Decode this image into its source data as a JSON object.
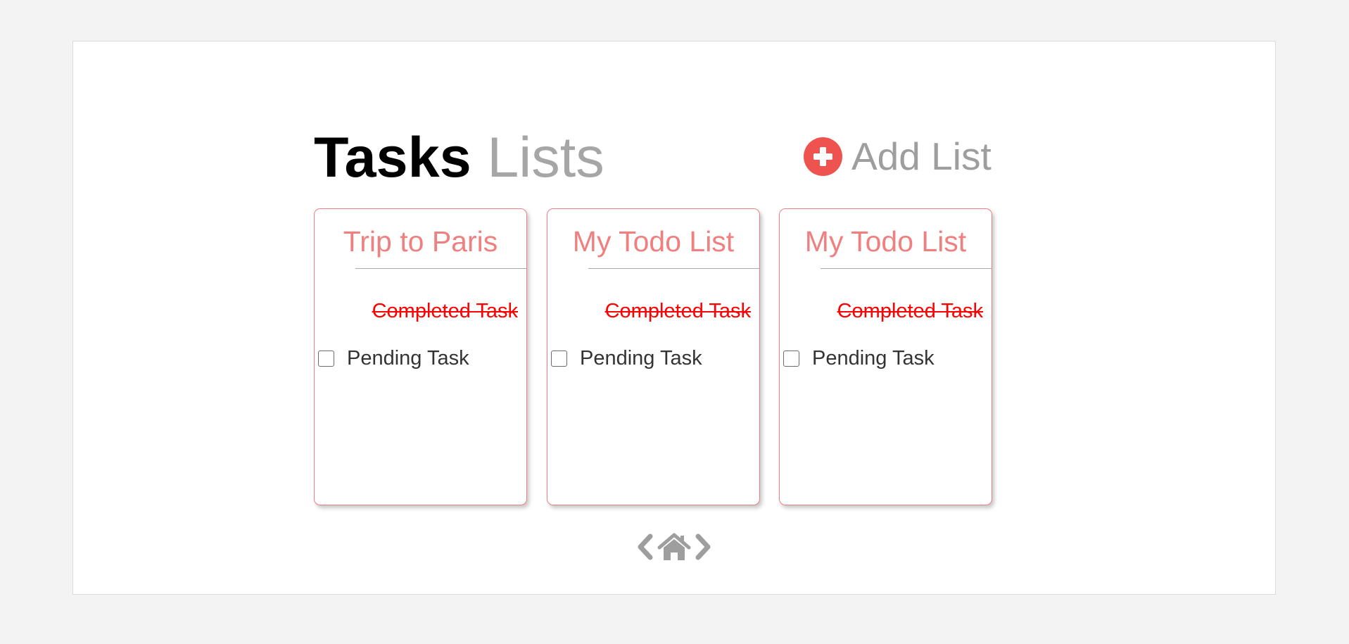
{
  "header": {
    "title_bold": "Tasks",
    "title_light": "Lists",
    "add_list_label": "Add List",
    "add_list_icon": "plus-circle-icon"
  },
  "lists": [
    {
      "title": "Trip to Paris",
      "completed_task": "Completed Task",
      "pending_task": "Pending Task",
      "pending_checked": false
    },
    {
      "title": "My Todo List",
      "completed_task": "Completed Task",
      "pending_task": "Pending Task",
      "pending_checked": false
    },
    {
      "title": "My Todo List",
      "completed_task": "Completed Task",
      "pending_task": "Pending Task",
      "pending_checked": false
    }
  ],
  "pager": {
    "prev_icon": "chevron-left-icon",
    "home_icon": "home-icon",
    "next_icon": "chevron-right-icon"
  },
  "colors": {
    "accent": "#ef5350",
    "card_title": "#f08080",
    "completed_task": "#ff0000",
    "muted_text": "#a6a6a6",
    "icon_gray": "#9e9e9e"
  }
}
